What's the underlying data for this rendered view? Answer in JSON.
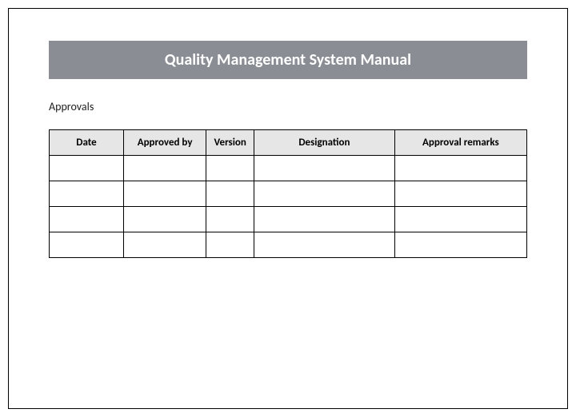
{
  "header": {
    "title": "Quality Management System Manual"
  },
  "section": {
    "label": "Approvals"
  },
  "table": {
    "headers": {
      "date": "Date",
      "approved_by": "Approved by",
      "version": "Version",
      "designation": "Designation",
      "remarks": "Approval remarks"
    },
    "rows": [
      {
        "date": "",
        "approved_by": "",
        "version": "",
        "designation": "",
        "remarks": ""
      },
      {
        "date": "",
        "approved_by": "",
        "version": "",
        "designation": "",
        "remarks": ""
      },
      {
        "date": "",
        "approved_by": "",
        "version": "",
        "designation": "",
        "remarks": ""
      },
      {
        "date": "",
        "approved_by": "",
        "version": "",
        "designation": "",
        "remarks": ""
      }
    ]
  }
}
